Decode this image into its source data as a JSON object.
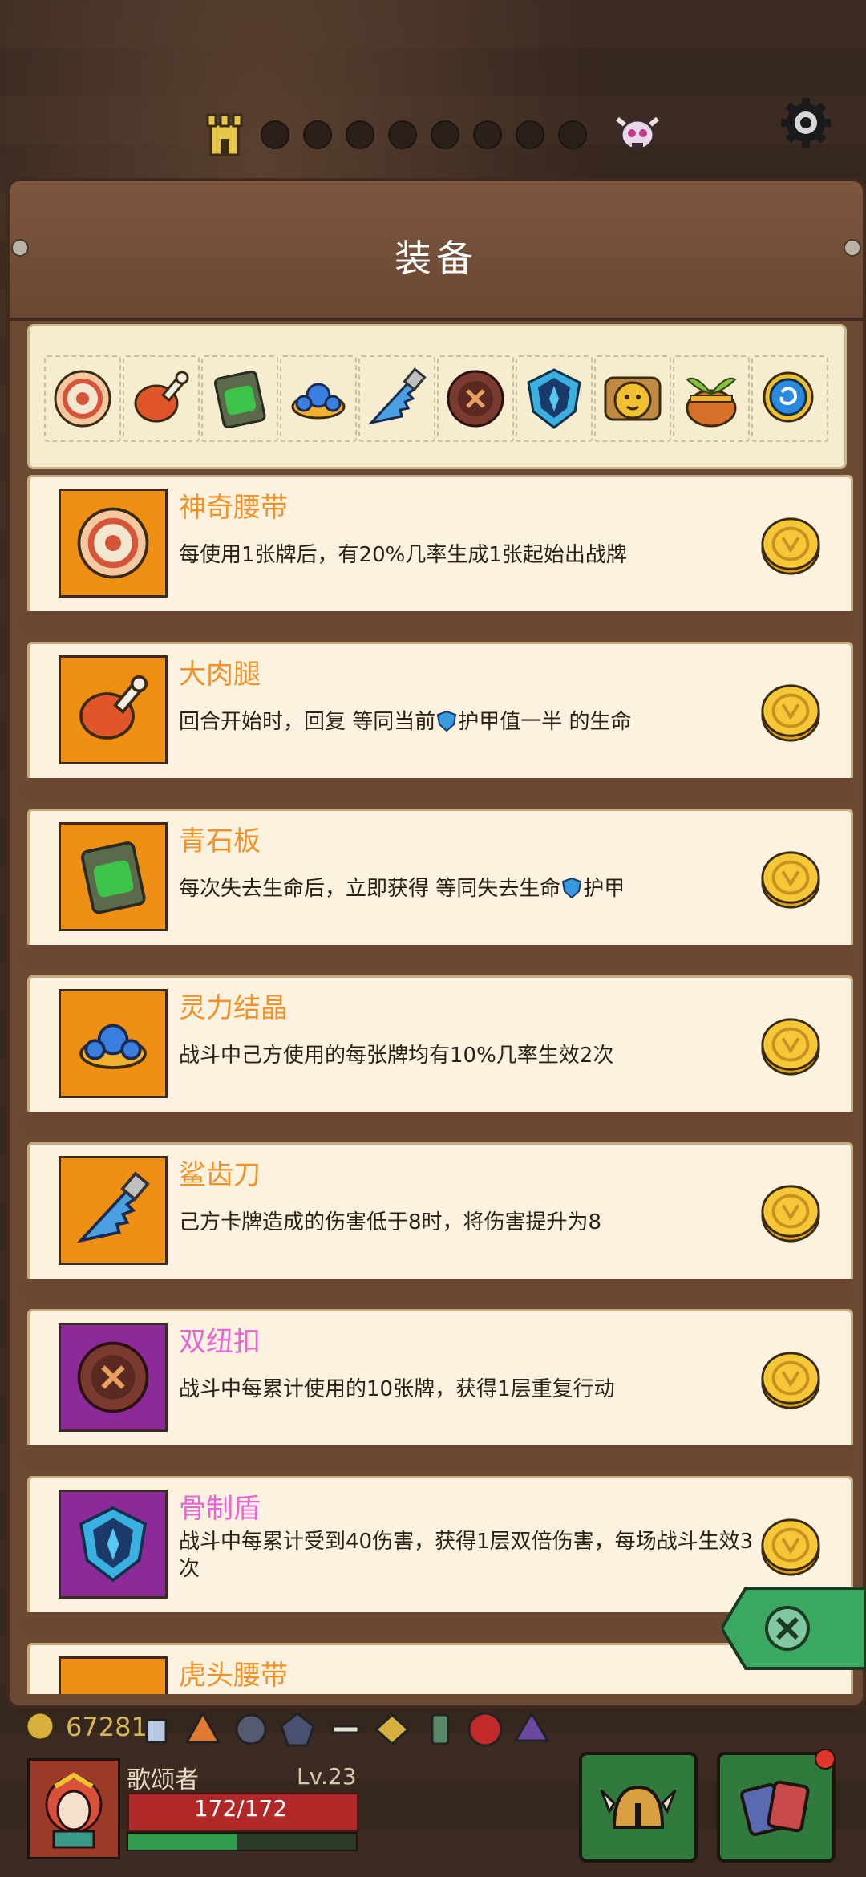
{
  "panel": {
    "title": "装备"
  },
  "strip_icons": [
    "belt-icon",
    "meat-leg-icon",
    "green-stone-icon",
    "crystal-icon",
    "shark-blade-icon",
    "button-icon",
    "bone-shield-icon",
    "tiger-belt-icon",
    "pot-icon",
    "orb-icon"
  ],
  "items": [
    {
      "name": "神奇腰带",
      "desc": "每使用1张牌后，有20%几率生成1张起始出战牌",
      "rarity_color": "#f0912a",
      "bg": "#ef8f14",
      "icon": "belt-icon"
    },
    {
      "name": "大肉腿",
      "desc_parts": [
        "回合开始时，回复 等同当前",
        "护甲值一半 的生命"
      ],
      "rarity_color": "#f0912a",
      "bg": "#ef8f14",
      "icon": "meat-leg-icon"
    },
    {
      "name": "青石板",
      "desc_parts": [
        "每次失去生命后，立即获得 等同失去生命",
        "护甲"
      ],
      "rarity_color": "#f0912a",
      "bg": "#ef8f14",
      "icon": "green-stone-icon"
    },
    {
      "name": "灵力结晶",
      "desc": "战斗中己方使用的每张牌均有10%几率生效2次",
      "rarity_color": "#f0912a",
      "bg": "#ef8f14",
      "icon": "crystal-icon"
    },
    {
      "name": "鲨齿刀",
      "desc": "己方卡牌造成的伤害低于8时，将伤害提升为8",
      "rarity_color": "#f0912a",
      "bg": "#ef8f14",
      "icon": "shark-blade-icon"
    },
    {
      "name": "双纽扣",
      "desc": "战斗中每累计使用的10张牌，获得1层重复行动",
      "rarity_color": "#e865d6",
      "bg": "#8c2a9a",
      "icon": "button-icon"
    },
    {
      "name": "骨制盾",
      "desc": "战斗中每累计受到40伤害，获得1层双倍伤害，每场战斗生效3次",
      "rarity_color": "#e865d6",
      "bg": "#8c2a9a",
      "icon": "bone-shield-icon"
    },
    {
      "name": "虎头腰带",
      "desc": "",
      "rarity_color": "#f0912a",
      "bg": "#ef8f14",
      "icon": "tiger-belt-icon"
    }
  ],
  "player": {
    "gold": "67281",
    "name": "歌颂者",
    "level": "Lv.23",
    "hp": "172/172",
    "xp_fraction": 0.48
  },
  "colors": {
    "orange_rarity": "#f0912a",
    "purple_rarity": "#e865d6"
  }
}
